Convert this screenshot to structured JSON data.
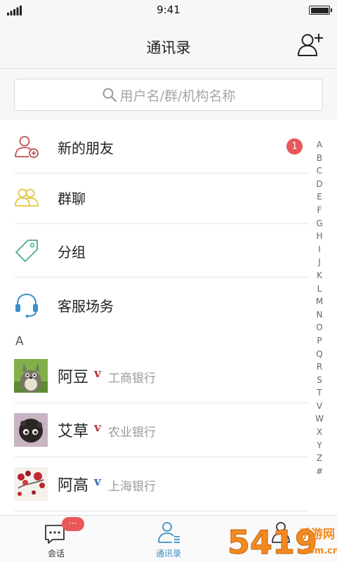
{
  "status_bar": {
    "time": "9:41"
  },
  "nav": {
    "title": "通讯录"
  },
  "search": {
    "placeholder": "用户名/群/机构名称"
  },
  "features": [
    {
      "label": "新的朋友",
      "badge": "1",
      "icon": "new-friend-icon",
      "color": "#c0504d"
    },
    {
      "label": "群聊",
      "icon": "group-chat-icon",
      "color": "#e3c43a"
    },
    {
      "label": "分组",
      "icon": "tag-icon",
      "color": "#4bae84"
    },
    {
      "label": "客服场务",
      "icon": "headset-icon",
      "color": "#3a8fc7"
    }
  ],
  "section": "A",
  "contacts": [
    {
      "name": "阿豆",
      "verify": "v",
      "verify_color": "#b83a3a",
      "org": "工商银行"
    },
    {
      "name": "艾草",
      "verify": "v",
      "verify_color": "#b83a3a",
      "org": "农业银行"
    },
    {
      "name": "阿高",
      "verify": "v",
      "verify_color": "#3a6fb8",
      "org": "上海银行"
    }
  ],
  "alpha_index": [
    "A",
    "B",
    "C",
    "D",
    "E",
    "F",
    "G",
    "H",
    "I",
    "J",
    "K",
    "L",
    "M",
    "N",
    "O",
    "P",
    "Q",
    "R",
    "S",
    "T",
    "V",
    "W",
    "X",
    "Y",
    "Z",
    "#"
  ],
  "tabs": [
    {
      "label": "会话",
      "badge": "···",
      "icon": "chat-bubble-icon"
    },
    {
      "label": "通讯录",
      "icon": "contacts-icon",
      "active": true
    },
    {
      "label": "",
      "icon": "profile-icon"
    }
  ],
  "watermark": {
    "text": "5419",
    "subtext": "手游网",
    "url_text": ".com.cn"
  },
  "colors": {
    "accent": "#3a8fc7",
    "badge": "#e8585a",
    "nav_bg": "#f7f7f7"
  }
}
